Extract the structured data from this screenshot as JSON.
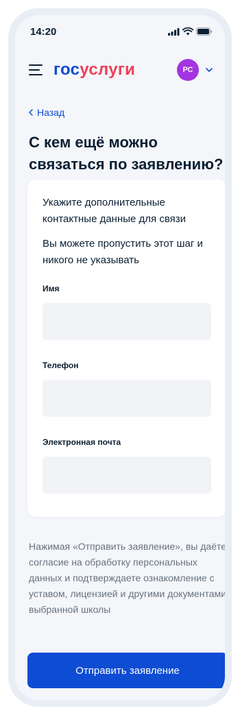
{
  "status_bar": {
    "time": "14:20"
  },
  "header": {
    "logo_part1": "гос",
    "logo_part2": "услуги",
    "avatar_initials": "РС"
  },
  "nav": {
    "back_label": "Назад"
  },
  "page": {
    "title": "С кем ещё можно связаться по заявлению?"
  },
  "card": {
    "intro": "Укажите дополнительные контактные данные для связи",
    "note": "Вы можете пропустить этот шаг и никого не указывать",
    "fields": [
      {
        "label": "Имя",
        "value": ""
      },
      {
        "label": "Телефон",
        "value": ""
      },
      {
        "label": "Электронная почта",
        "value": ""
      }
    ]
  },
  "consent_text": "Нажимая «Отправить заявление», вы даёте согласие на обработку персональных данных и подтверждаете ознакомление с уставом, лицензией и другими документами выбранной школы",
  "submit_label": "Отправить заявление",
  "colors": {
    "brand_blue": "#0d4cd3",
    "brand_red": "#ee3f58",
    "avatar": "#a434e0",
    "background": "#f4f6fa"
  },
  "icons": [
    "signal-icon",
    "wifi-icon",
    "battery-icon",
    "menu-icon",
    "chevron-down-icon",
    "chevron-left-icon"
  ]
}
